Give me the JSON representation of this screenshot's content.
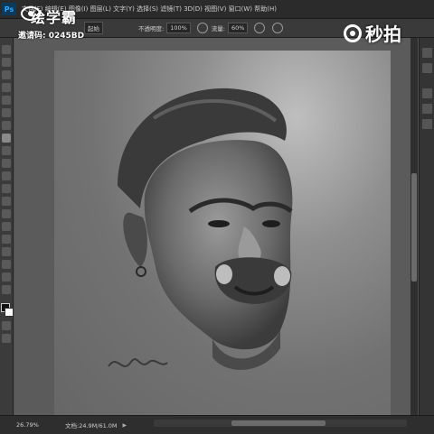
{
  "app": {
    "logo": "Ps"
  },
  "menubar": {
    "items_text": "文件(F)  编辑(E)  图像(I)  图层(L)  文字(Y)  选择(S)  滤镜(T)  3D(D)  视图(V)  窗口(W)  帮助(H)"
  },
  "options": {
    "preset": "起始",
    "opacity_label": "不透明度:",
    "opacity_value": "100%",
    "flow_label": "流量:",
    "flow_value": "60%"
  },
  "watermark": {
    "brand": "绘学霸",
    "code": "邀请码: 0245BD",
    "right_brand": "秒拍"
  },
  "status": {
    "zoom": "26.79%",
    "docsize": "文档:24.9M/61.0M"
  },
  "colors": {
    "foreground": "#111111",
    "background": "#ffffff"
  },
  "icons": [
    "ps-logo-icon",
    "brush-icon",
    "airbrush-icon",
    "pressure-icon"
  ]
}
